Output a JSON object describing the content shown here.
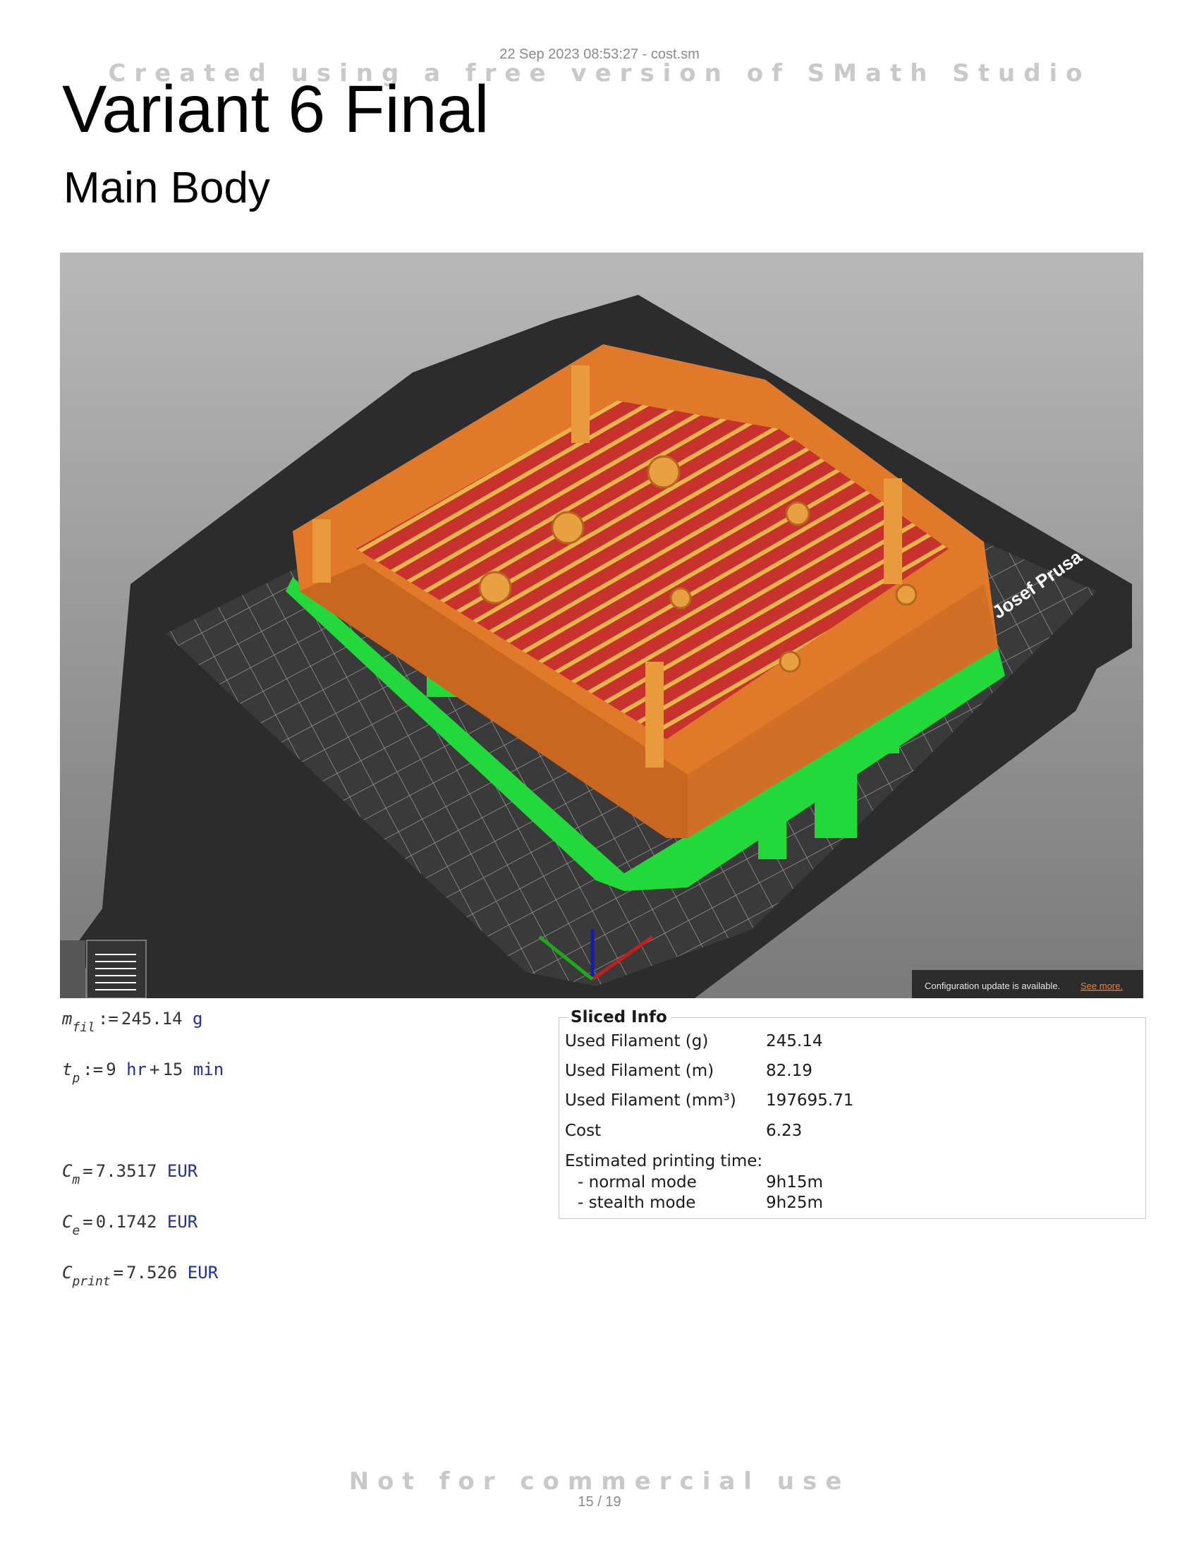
{
  "header": {
    "meta": "22 Sep 2023 08:53:27 - cost.sm",
    "watermark_top": "Created using a free version of SMath Studio",
    "watermark_bottom": "Not for commercial use",
    "page": "15 / 19"
  },
  "title": "Variant 6 Final",
  "subtitle": "Main Body",
  "viewer": {
    "bed_brand": "Josef Prusa",
    "notification_text": "Configuration update is available.",
    "notification_link": "See more.",
    "colors": {
      "part_orange": "#e07a2a",
      "infill_red": "#c8322d",
      "support_green": "#22d83a",
      "bed_dark": "#2d2d2d",
      "background_top": "#b5b5b5",
      "background_bottom": "#7d7d7d"
    }
  },
  "math": {
    "m_fil": {
      "var": "m",
      "sub": "fil",
      "op": ":=",
      "value": "245.14",
      "unit": "g"
    },
    "t_p": {
      "var": "t",
      "sub": "p",
      "op": ":=",
      "v1": "9",
      "u1": "hr",
      "plus": "+",
      "v2": "15",
      "u2": "min"
    },
    "C_m": {
      "var": "C",
      "sub": "m",
      "op": "=",
      "value": "7.3517",
      "unit": "EUR"
    },
    "C_e": {
      "var": "C",
      "sub": "e",
      "op": "=",
      "value": "0.1742",
      "unit": "EUR"
    },
    "C_print": {
      "var": "C",
      "sub": "print",
      "op": "=",
      "value": "7.526",
      "unit": "EUR"
    }
  },
  "sliced_info": {
    "title": "Sliced Info",
    "rows": [
      {
        "label": "Used Filament (g)",
        "value": "245.14"
      },
      {
        "label": "Used Filament (m)",
        "value": "82.19"
      },
      {
        "label": "Used Filament (mm³)",
        "value": "197695.71"
      },
      {
        "label": "Cost",
        "value": "6.23"
      },
      {
        "label": "Estimated printing time:",
        "value": ""
      },
      {
        "label": "  - normal mode",
        "value": "9h15m"
      },
      {
        "label": "  - stealth mode",
        "value": "9h25m"
      }
    ]
  }
}
